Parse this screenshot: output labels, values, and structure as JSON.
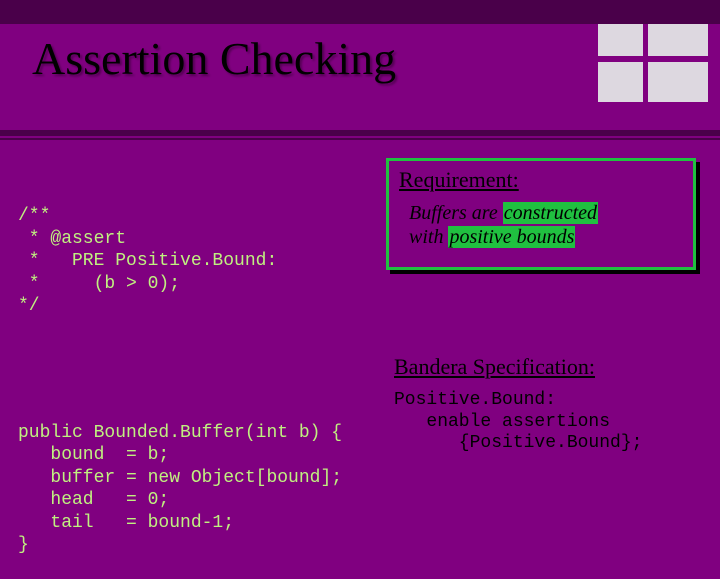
{
  "title": "Assertion Checking",
  "code_top": "/**\n * @assert\n *   PRE Positive.Bound:\n *     (b > 0);\n*/",
  "code_bottom": "public Bounded.Buffer(int b) {\n   bound  = b;\n   buffer = new Object[bound];\n   head   = 0;\n   tail   = bound-1;\n}",
  "req": {
    "heading": "Requirement:",
    "line1_a": "Buffers are",
    "line1_b": "constructed",
    "line2_a": "with",
    "line2_b": "positive bounds"
  },
  "bspec": {
    "heading": "Bandera Specification:",
    "code": "Positive.Bound:\n   enable assertions\n      {Positive.Bound};"
  }
}
